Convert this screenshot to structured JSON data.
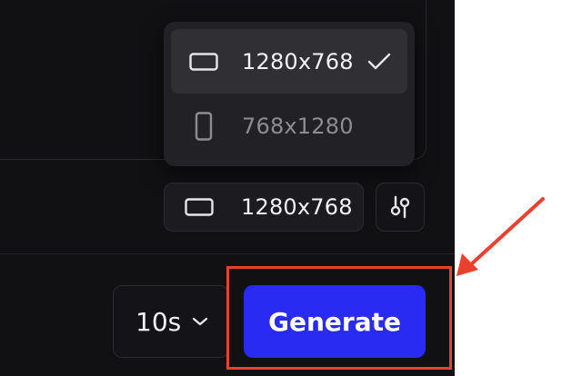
{
  "resolution_menu": {
    "options": [
      {
        "label": "1280x768",
        "icon": "landscape-rect-icon",
        "selected": true
      },
      {
        "label": "768x1280",
        "icon": "portrait-rect-icon",
        "selected": false
      }
    ],
    "check_icon": "check-icon"
  },
  "resolution_trigger": {
    "label": "1280x768",
    "icon": "landscape-rect-icon"
  },
  "settings_button": {
    "icon": "sliders-icon"
  },
  "duration": {
    "label": "10s",
    "icon": "chevron-down-icon"
  },
  "generate": {
    "label": "Generate"
  },
  "colors": {
    "panel_bg": "#111114",
    "accent": "#2a2bf2",
    "annotation": "#e8412f",
    "text_primary": "#f2f2f4",
    "text_muted": "#8c8c93"
  }
}
